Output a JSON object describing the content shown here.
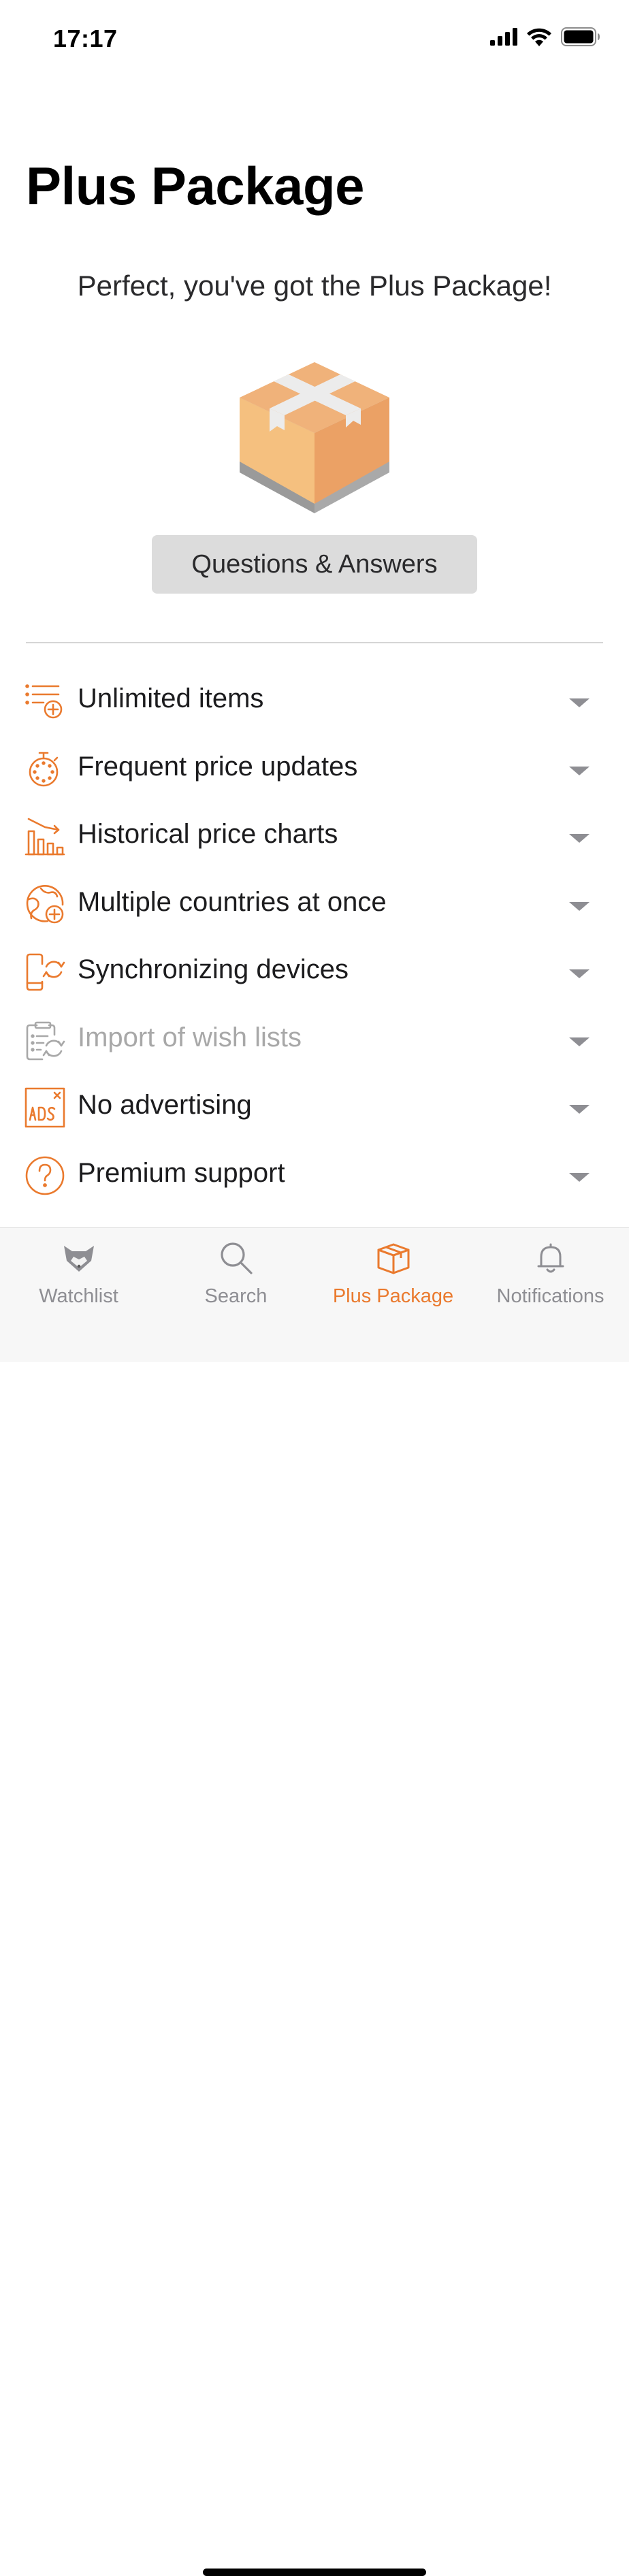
{
  "status": {
    "time": "17:17"
  },
  "page": {
    "title": "Plus Package",
    "subtitle": "Perfect, you've got the Plus Package!",
    "qa_button": "Questions & Answers"
  },
  "colors": {
    "accent": "#ea7a2e",
    "muted": "#a8a8a8",
    "box_light": "#f5c07f",
    "box_dark": "#eba165",
    "tape": "#ececec"
  },
  "features": [
    {
      "label": "Unlimited items",
      "icon": "list-add-icon",
      "enabled": true
    },
    {
      "label": "Frequent price updates",
      "icon": "stopwatch-icon",
      "enabled": true
    },
    {
      "label": "Historical price charts",
      "icon": "price-chart-icon",
      "enabled": true
    },
    {
      "label": "Multiple countries at once",
      "icon": "globe-add-icon",
      "enabled": true
    },
    {
      "label": "Synchronizing devices",
      "icon": "sync-device-icon",
      "enabled": true
    },
    {
      "label": "Import of wish lists",
      "icon": "clipboard-import-icon",
      "enabled": false
    },
    {
      "label": "No advertising",
      "icon": "no-ads-icon",
      "enabled": true
    },
    {
      "label": "Premium support",
      "icon": "help-circle-icon",
      "enabled": true
    }
  ],
  "tabs": [
    {
      "label": "Watchlist",
      "icon": "fox-icon",
      "active": false
    },
    {
      "label": "Search",
      "icon": "search-icon",
      "active": false
    },
    {
      "label": "Plus Package",
      "icon": "package-icon",
      "active": true
    },
    {
      "label": "Notifications",
      "icon": "bell-icon",
      "active": false
    }
  ]
}
